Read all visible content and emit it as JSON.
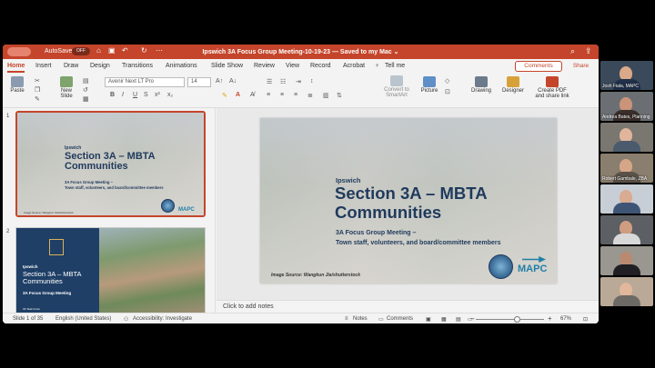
{
  "window": {
    "autosave_label": "AutoSave",
    "autosave_state": "OFF",
    "doc_title": "Ipswich 3A Focus Group Meeting-10-19-23 — Saved to my Mac ⌄"
  },
  "tabs": [
    "Home",
    "Insert",
    "Draw",
    "Design",
    "Transitions",
    "Animations",
    "Slide Show",
    "Review",
    "View",
    "Record",
    "Acrobat"
  ],
  "tell_me": "Tell me",
  "comments_button": "Comments",
  "share_button": "Share",
  "ribbon": {
    "paste": "Paste",
    "new_slide": "New\nSlide",
    "font_name": "Avenir Next LT Pro",
    "font_size": "14",
    "convert_smartart": "Convert to\nSmartArt",
    "picture": "Picture",
    "drawing": "Drawing",
    "designer": "Designer",
    "create_pdf": "Create PDF\nand share link"
  },
  "slides": [
    {
      "number": "1",
      "city": "Ipswich",
      "title": "Section 3A – MBTA Communities",
      "subtitle_line1": "3A Focus Group Meeting –",
      "subtitle_line2": "Town staff, volunteers, and board/committee members",
      "image_source": "Image Source: Wangkun Jia/shutterstock",
      "logo_text": "MAPC"
    },
    {
      "number": "2",
      "city": "Ipswich",
      "title": "Section 3A – MBTA Communities",
      "subtitle": "3A Focus Group Meeting",
      "footer": "3A Task Force"
    }
  ],
  "main_slide": {
    "city": "Ipswich",
    "title_line1": "Section 3A – MBTA",
    "title_line2": "Communities",
    "subtitle_line1": "3A Focus Group Meeting –",
    "subtitle_line2": "Town staff, volunteers, and board/committee members",
    "image_source": "Image Source: Wangkun Jia/shutterstock",
    "logo_text": "MAPC"
  },
  "notes_placeholder": "Click to add notes",
  "status": {
    "slide": "Slide 1 of 35",
    "language": "English (United States)",
    "accessibility": "Accessibility: Investigate",
    "notes": "Notes",
    "comments": "Comments",
    "zoom": "67%"
  },
  "participants": [
    {
      "name": "Josh Fiala, MAPC"
    },
    {
      "name": "Andrea Bates, Planning"
    },
    {
      "name": ""
    },
    {
      "name": "Robert Gambale, ZBA"
    },
    {
      "name": ""
    },
    {
      "name": ""
    },
    {
      "name": ""
    },
    {
      "name": ""
    }
  ],
  "colors": {
    "accent": "#c4452b",
    "slide_navy": "#1f3a5c",
    "mapc_blue": "#1f7fa6"
  }
}
